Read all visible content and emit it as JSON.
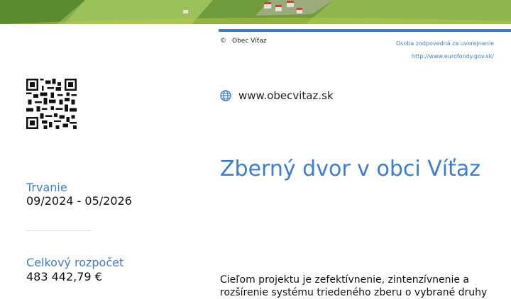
{
  "header": {
    "copyright_symbol": "©",
    "copyright_owner": "Obec Víťaz",
    "responsible_label": "Osoba zodpovedná za uverejnenie",
    "responsible_url": "http://www.eurofondy.gov.sk/"
  },
  "contact": {
    "website": "www.obecvitaz.sk",
    "globe_icon": "globe-icon",
    "qr_icon": "qr-code-icon"
  },
  "project": {
    "title": "Zberný dvor v obci Víťaz",
    "duration_label": "Trvanie",
    "duration_value": "09/2024 - 05/2026",
    "budget_label": "Celkový rozpočet",
    "budget_value": "483 442,79 €",
    "description": "Cieľom projektu je zefektívnenie, zintenzívnenie a rozšírenie systému triedeného zberu o vybrané druhy"
  },
  "colors": {
    "accent": "#3e7ec9",
    "banner_green": "#89b24e"
  }
}
